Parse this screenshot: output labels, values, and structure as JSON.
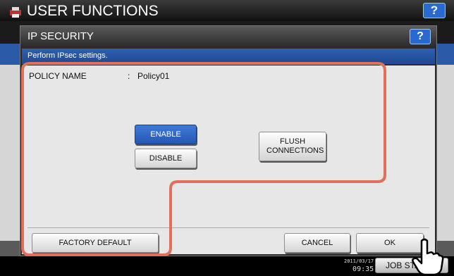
{
  "background": {
    "title": "USER FUNCTIONS",
    "help_label": "?",
    "clock_line1": "2011/03/17",
    "clock_line2": "09:35",
    "job_status_label": "JOB STATUS"
  },
  "dialog": {
    "title": "IP SECURITY",
    "help_label": "?",
    "subtitle": "Perform IPsec settings.",
    "policy": {
      "label": "POLICY NAME",
      "colon": ":",
      "value": "Policy01"
    },
    "buttons": {
      "enable": "ENABLE",
      "disable": "DISABLE",
      "flush": "FLUSH CONNECTIONS",
      "factory_default": "FACTORY DEFAULT",
      "cancel": "CANCEL",
      "ok": "OK"
    }
  },
  "colors": {
    "accent_blue": "#2a5aa8",
    "highlight": "#e0705c",
    "selected_button": "#2c63c4"
  }
}
